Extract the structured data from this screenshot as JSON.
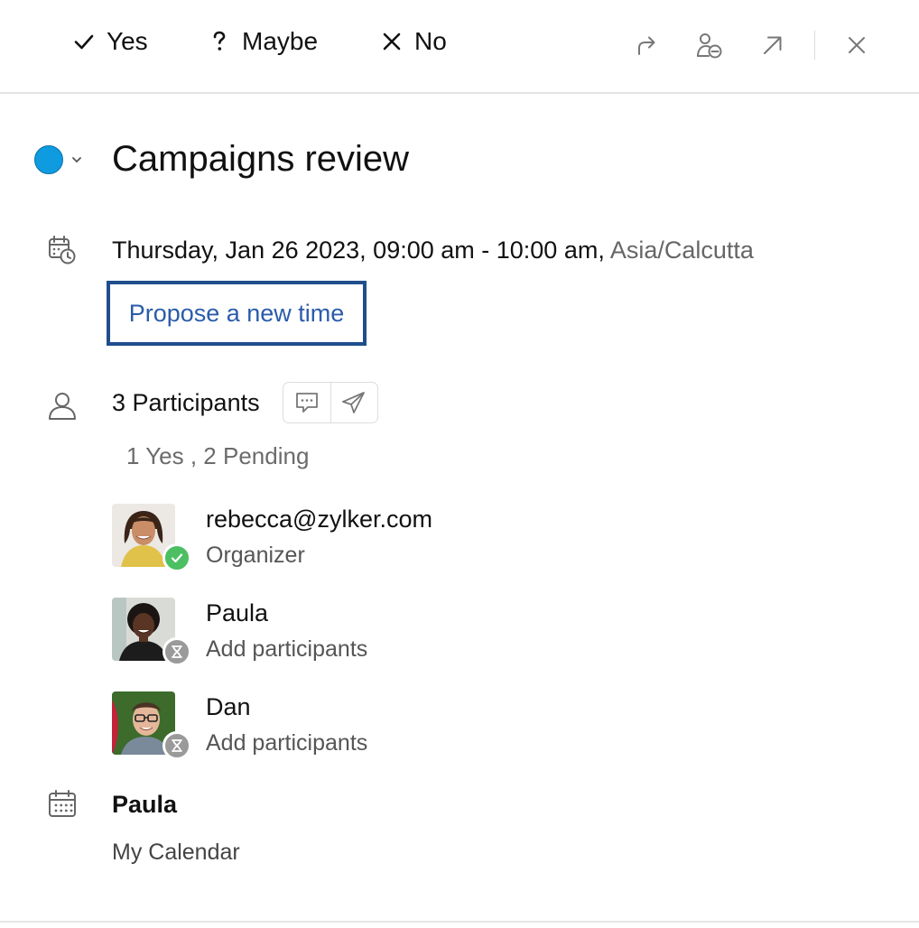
{
  "toolbar": {
    "rsvp": {
      "yes_label": "Yes",
      "maybe_label": "Maybe",
      "no_label": "No"
    },
    "icons": [
      "forward-icon",
      "delegate-icon",
      "open-external-icon",
      "close-icon"
    ]
  },
  "event": {
    "color": "#0f9be0",
    "title": "Campaigns review",
    "datetime": "Thursday, Jan 26 2023,  09:00 am  - 10:00 am,",
    "timezone": "Asia/Calcutta",
    "propose_label": "Propose a new time"
  },
  "participants": {
    "count_label": "3 Participants",
    "summary": "1 Yes , 2 Pending",
    "list": [
      {
        "name": "rebecca@zylker.com",
        "role": "Organizer",
        "status": "accepted",
        "status_color": "#4cbf62"
      },
      {
        "name": "Paula",
        "role": "Add participants",
        "status": "pending",
        "status_color": "#9a9a9a"
      },
      {
        "name": "Dan",
        "role": "Add participants",
        "status": "pending",
        "status_color": "#9a9a9a"
      }
    ]
  },
  "calendar": {
    "owner": "Paula",
    "name": "My Calendar"
  }
}
